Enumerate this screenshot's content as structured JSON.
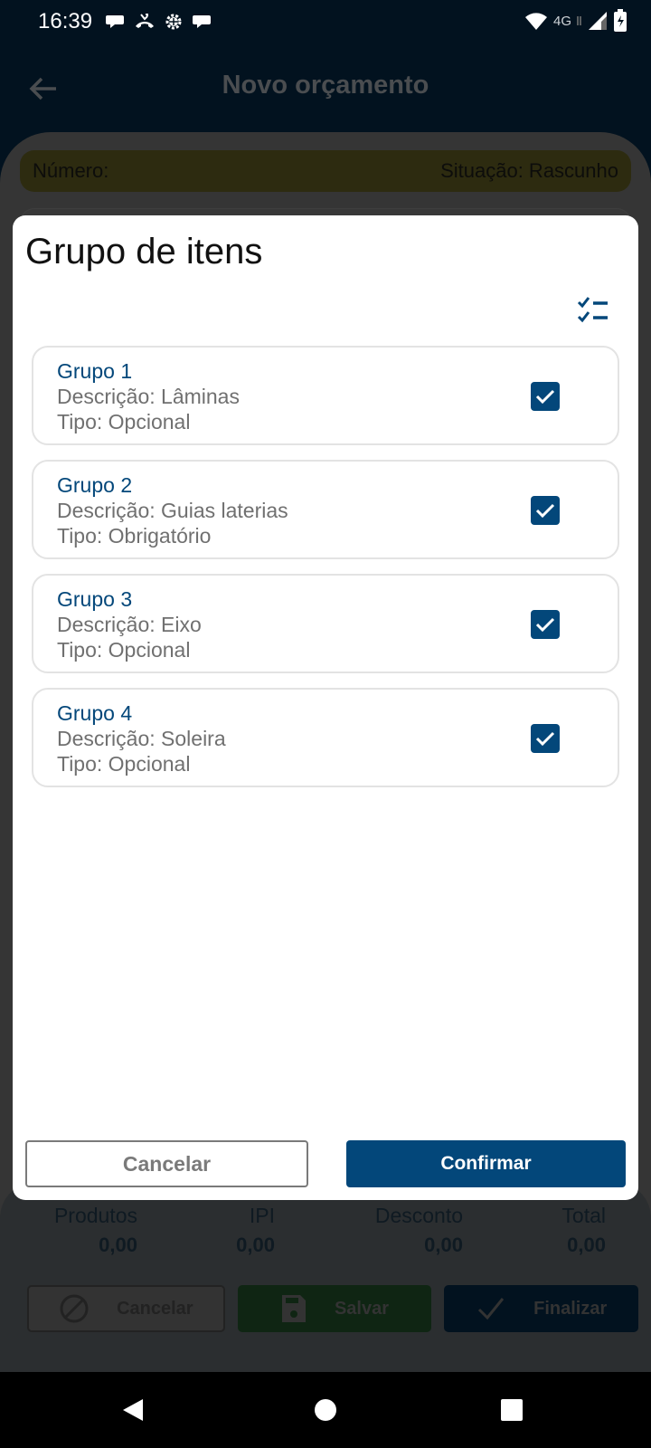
{
  "status_bar": {
    "time": "16:39",
    "notification_icons": [
      "chat-bubble-icon",
      "missed-call-icon",
      "android-settings-icon",
      "chat-bubble-icon"
    ],
    "network_label": "4G"
  },
  "header": {
    "title": "Novo orçamento"
  },
  "info_bar": {
    "number_label": "Número:",
    "status_text": "Situação: Rascunho"
  },
  "totals": [
    {
      "label": "Produtos",
      "value": "0,00"
    },
    {
      "label": "IPI",
      "value": "0,00"
    },
    {
      "label": "Desconto",
      "value": "0,00"
    },
    {
      "label": "Total",
      "value": "0,00"
    }
  ],
  "actions": {
    "cancel_label": "Cancelar",
    "save_label": "Salvar",
    "finish_label": "Finalizar"
  },
  "dialog": {
    "title": "Grupo de itens",
    "groups": [
      {
        "name": "Grupo 1",
        "description": "Descrição: Lâminas",
        "type": "Tipo: Opcional",
        "checked": true
      },
      {
        "name": "Grupo 2",
        "description": "Descrição: Guias laterias",
        "type": "Tipo: Obrigatório",
        "checked": true
      },
      {
        "name": "Grupo 3",
        "description": "Descrição: Eixo",
        "type": "Tipo: Opcional",
        "checked": true
      },
      {
        "name": "Grupo 4",
        "description": "Descrição: Soleira",
        "type": "Tipo: Opcional",
        "checked": true
      }
    ],
    "cancel_label": "Cancelar",
    "confirm_label": "Confirmar"
  },
  "colors": {
    "primary": "#03477a",
    "status_bar_bg": "#02121f",
    "dim_overlay_bg": "#353535",
    "info_bar_bg": "#2d2b10"
  }
}
